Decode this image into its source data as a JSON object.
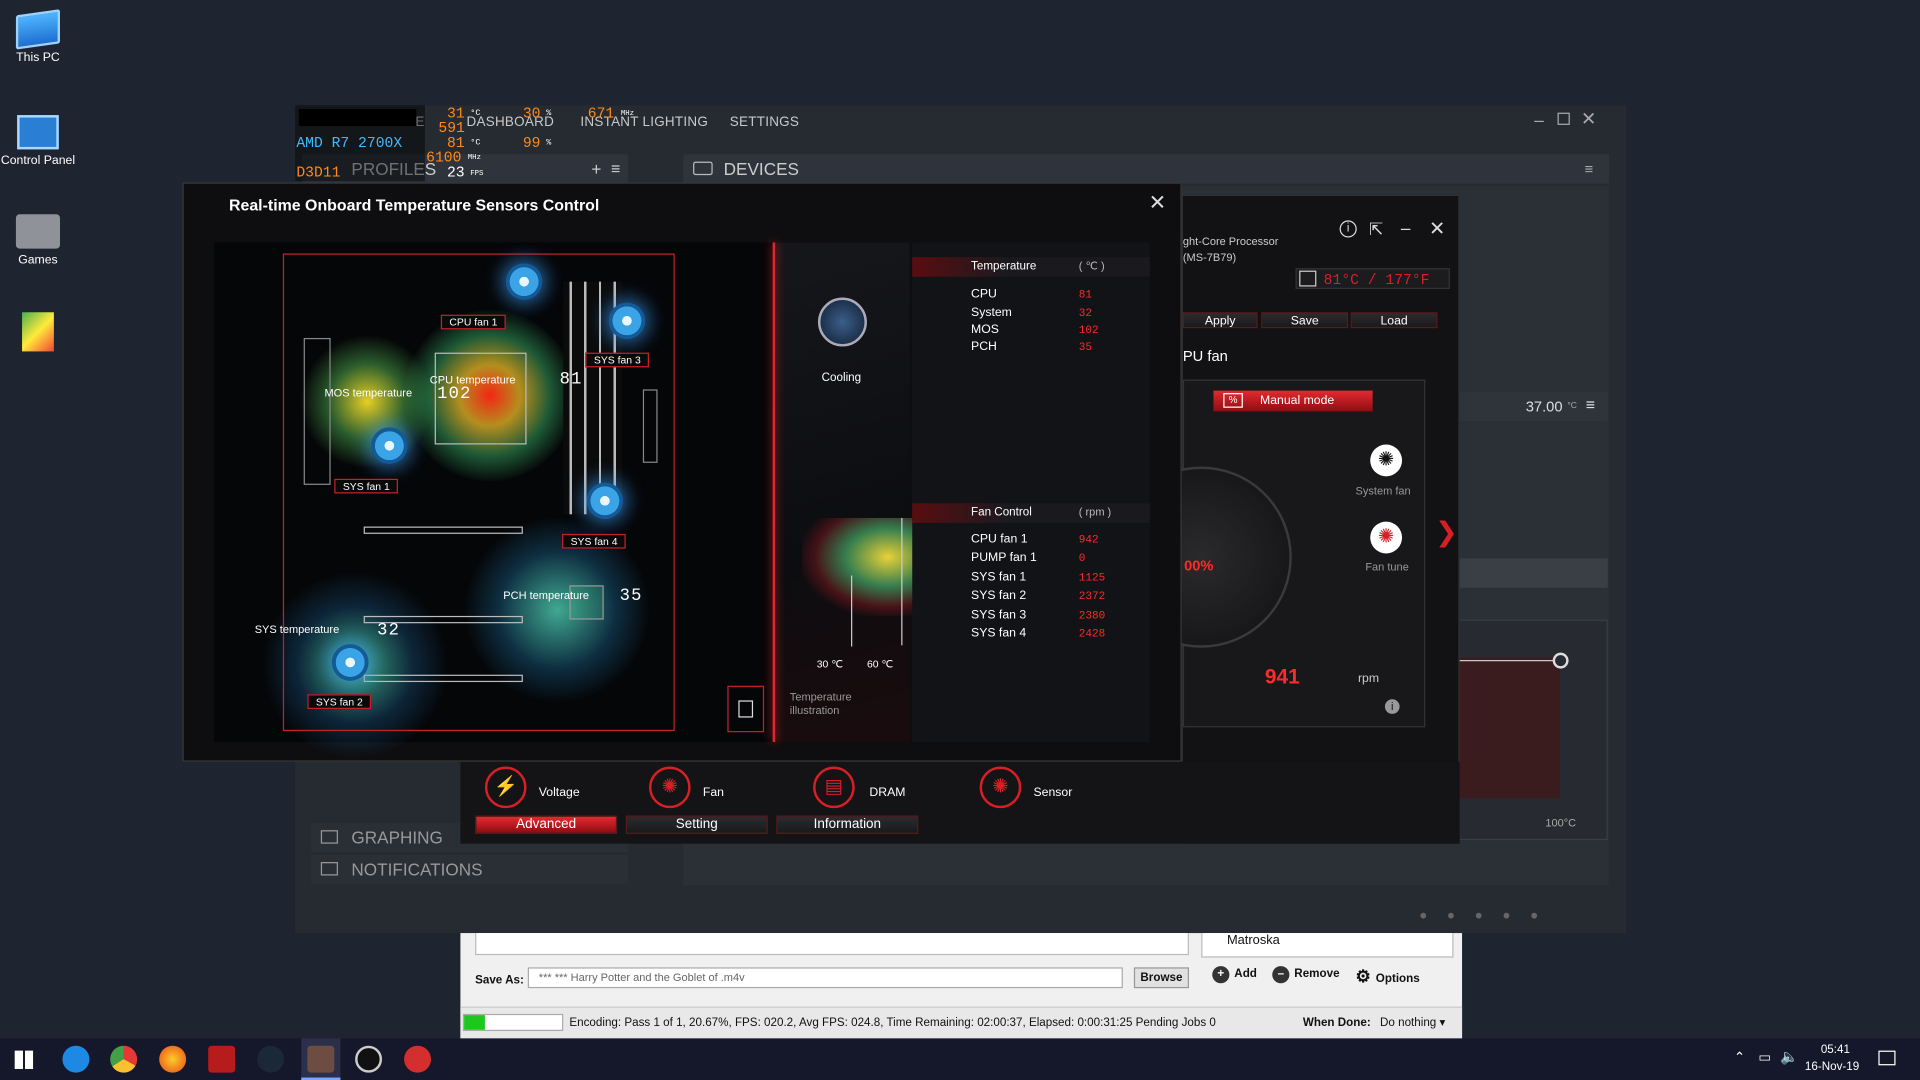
{
  "desktop": {
    "icons": [
      {
        "label": "This PC"
      },
      {
        "label": "Control Panel"
      },
      {
        "label": "Games"
      },
      {
        "label": ""
      }
    ]
  },
  "icue": {
    "nav": [
      "HOME",
      "DASHBOARD",
      "INSTANT LIGHTING",
      "SETTINGS"
    ],
    "profiles_label": "PROFILES",
    "devices_label": "DEVICES",
    "graphing_label": "GRAPHING",
    "notifications_label": "NOTIFICATIONS",
    "temp_value": "37.00",
    "temp_unit": "°C",
    "graph_end_label": "100°C"
  },
  "osd": {
    "cpu_name": "AMD R7 2700X",
    "api": "D3D11",
    "gpu_temp": "31",
    "gpu_load": "30",
    "gpu_clock": "671",
    "gpu_mem": "591",
    "cpu_temp": "81",
    "cpu_load": "99",
    "cpu_clock": "6100",
    "fps": "23",
    "u_c": "°C",
    "u_pct": "%",
    "u_mhz": "MHz",
    "u_fps": "FPS"
  },
  "rt_dialog": {
    "title": "Real-time Onboard Temperature Sensors Control",
    "labels": {
      "cpu_fan1": "CPU fan 1",
      "sys_fan3": "SYS fan 3",
      "sys_fan1": "SYS fan 1",
      "sys_fan4": "SYS fan 4",
      "sys_fan2": "SYS fan 2",
      "mos_temp": "MOS temperature",
      "cpu_temp": "CPU temperature",
      "pch_temp": "PCH temperature",
      "sys_temp": "SYS temperature"
    },
    "board_values": {
      "cpu": "102",
      "pch": "35",
      "sys": "32",
      "mem": "81"
    },
    "cooling_label": "Cooling",
    "temp_scale": {
      "low": "30 ℃",
      "high": "60 ℃"
    },
    "illustration_label": "Temperature illustration",
    "temperature": {
      "header": "Temperature",
      "unit": "( ℃ )",
      "rows": [
        {
          "name": "CPU",
          "value": "81"
        },
        {
          "name": "System",
          "value": "32"
        },
        {
          "name": "MOS",
          "value": "102"
        },
        {
          "name": "PCH",
          "value": "35"
        }
      ]
    },
    "fan_control": {
      "header": "Fan Control",
      "unit": "( rpm )",
      "rows": [
        {
          "name": "CPU fan 1",
          "value": "942"
        },
        {
          "name": "PUMP fan 1",
          "value": "0"
        },
        {
          "name": "SYS fan 1",
          "value": "1125"
        },
        {
          "name": "SYS fan 2",
          "value": "2372"
        },
        {
          "name": "SYS fan 3",
          "value": "2380"
        },
        {
          "name": "SYS fan 4",
          "value": "2428"
        }
      ]
    }
  },
  "msi_window": {
    "processor": "ght-Core Processor",
    "model": "(MS-7B79)",
    "cpu_readout": "81°C / 177°F",
    "buttons": {
      "apply": "Apply",
      "save": "Save",
      "load": "Load"
    },
    "section_title": "PU fan",
    "mode_label": "Manual mode",
    "system_fan": "System fan",
    "fan_tune": "Fan tune",
    "percent": "00%",
    "rpm_value": "941",
    "rpm_unit": "rpm",
    "bottom": {
      "voltage": "Voltage",
      "fan": "Fan",
      "dram": "DRAM",
      "sensor": "Sensor",
      "advanced": "Advanced",
      "setting": "Setting",
      "information": "Information"
    }
  },
  "handbrake": {
    "matroska": "Matroska",
    "save_as_label": "Save As:",
    "save_as_value": "*** *** Harry Potter and the Goblet of      .m4v",
    "browse": "Browse",
    "add": "Add",
    "remove": "Remove",
    "options": "Options",
    "status": "Encoding: Pass 1 of 1,  20.67%, FPS: 020.2,  Avg FPS: 024.8,  Time Remaining: 02:00:37,  Elapsed: 0:00:31:25    Pending Jobs 0",
    "when_done_label": "When Done:",
    "when_done_value": "Do nothing",
    "progress": 0.2067
  },
  "taskbar": {
    "time": "05:41",
    "date": "16-Nov-19"
  },
  "colors": {
    "accent": "#d91f26",
    "osd_orange": "#ff8a1a",
    "osd_cyan": "#3fb8ff"
  }
}
